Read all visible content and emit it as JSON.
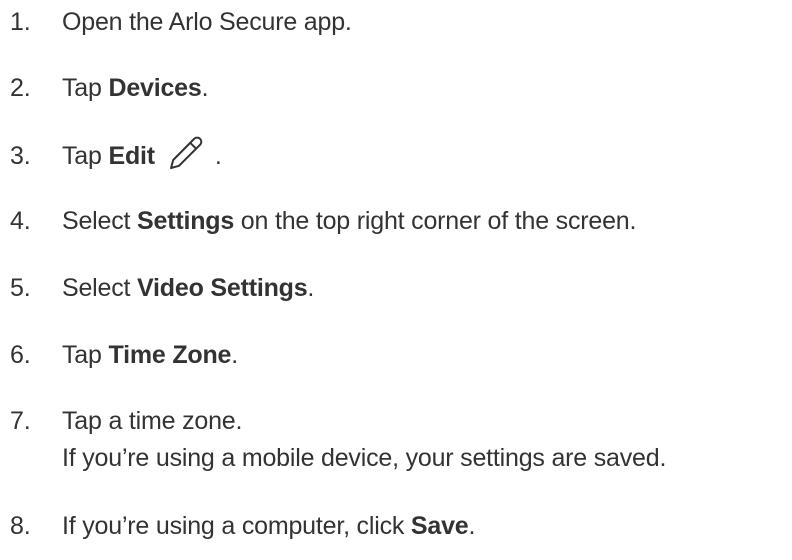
{
  "steps": [
    {
      "number": "1.",
      "parts": [
        "Open the Arlo Secure app."
      ]
    },
    {
      "number": "2.",
      "before": "Tap ",
      "bold": "Devices",
      "after": "."
    },
    {
      "number": "3.",
      "before": "Tap ",
      "bold": "Edit",
      "after": ".",
      "icon": "pencil-icon"
    },
    {
      "number": "4.",
      "before": "Select ",
      "bold": "Settings",
      "after": " on the top right corner of the screen."
    },
    {
      "number": "5.",
      "before": "Select ",
      "bold": "Video Settings",
      "after": "."
    },
    {
      "number": "6.",
      "before": "Tap ",
      "bold": "Time Zone",
      "after": "."
    },
    {
      "number": "7.",
      "text": "Tap a time zone.",
      "subtext": "If you’re using a mobile device, your settings are saved."
    },
    {
      "number": "8.",
      "before": "If you’re using a computer, click ",
      "bold": "Save",
      "after": "."
    }
  ]
}
